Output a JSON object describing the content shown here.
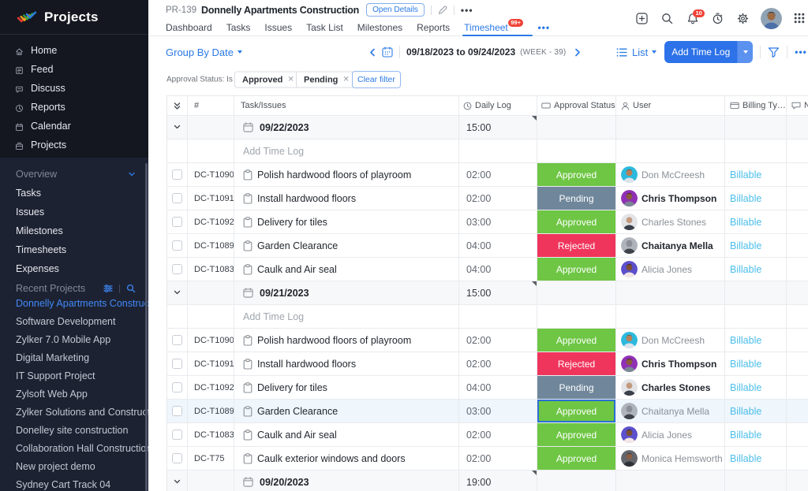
{
  "sidebar": {
    "logo_text": "Projects",
    "menu": [
      {
        "icon": "home-icon",
        "label": "Home"
      },
      {
        "icon": "feed-icon",
        "label": "Feed"
      },
      {
        "icon": "discuss-icon",
        "label": "Discuss"
      },
      {
        "icon": "reports-icon",
        "label": "Reports"
      },
      {
        "icon": "calendar-icon",
        "label": "Calendar"
      },
      {
        "icon": "projects-icon",
        "label": "Projects"
      }
    ],
    "overview_label": "Overview",
    "overview_items": [
      "Tasks",
      "Issues",
      "Milestones",
      "Timesheets",
      "Expenses"
    ],
    "recent_label": "Recent Projects",
    "recent_items": [
      {
        "label": "Donnelly Apartments Construct",
        "active": true
      },
      {
        "label": "Software Development",
        "active": false
      },
      {
        "label": "Zylker 7.0 Mobile App",
        "active": false
      },
      {
        "label": "Digital Marketing",
        "active": false
      },
      {
        "label": "IT Support Project",
        "active": false
      },
      {
        "label": "Zylsoft Web App",
        "active": false
      },
      {
        "label": "Zylker Solutions and Constructio",
        "active": false
      },
      {
        "label": "Donelley site construction",
        "active": false
      },
      {
        "label": "Collaboration Hall Constructions",
        "active": false
      },
      {
        "label": "New project demo",
        "active": false
      },
      {
        "label": "Sydney Cart Track 04",
        "active": false
      }
    ]
  },
  "header": {
    "project_id": "PR-139",
    "project_name": "Donnelly Apartments Construction",
    "open_details_label": "Open Details",
    "tabs": [
      "Dashboard",
      "Tasks",
      "Issues",
      "Task List",
      "Milestones",
      "Reports"
    ],
    "active_tab": "Timesheet",
    "active_tab_badge": "99+",
    "notification_count": "10"
  },
  "toolbar": {
    "group_by_label": "Group By Date",
    "date_range": "09/18/2023 to 09/24/2023",
    "week_label": "(WEEK - 39)",
    "view_label": "List",
    "add_button_label": "Add Time Log"
  },
  "filter": {
    "label": "Approval Status: Is",
    "chips": [
      "Approved",
      "Pending"
    ],
    "chip_close": "✕",
    "clear_label": "Clear filter"
  },
  "table": {
    "headers": {
      "id": "#",
      "task": "Task/Issues",
      "log": "Daily Log",
      "status": "Approval Status",
      "user": "User",
      "billing": "Billing Type",
      "notes": "Notes"
    },
    "add_row_label": "Add Time Log",
    "groups": [
      {
        "date": "09/22/2023",
        "total": "15:00",
        "rows": [
          {
            "id": "DC-T1090",
            "task": "Polish hardwood floors of playroom",
            "log": "02:00",
            "status": "Approved",
            "status_key": "approved",
            "user": "Don McCreesh",
            "avatar": "don",
            "user_dark": false,
            "billing": "Billable",
            "selected": false
          },
          {
            "id": "DC-T1091",
            "task": "Install hardwood floors",
            "log": "02:00",
            "status": "Pending",
            "status_key": "pending",
            "user": "Chris Thompson",
            "avatar": "chris",
            "user_dark": true,
            "billing": "Billable",
            "selected": false
          },
          {
            "id": "DC-T1092",
            "task": "Delivery for tiles",
            "log": "03:00",
            "status": "Approved",
            "status_key": "approved",
            "user": "Charles Stones",
            "avatar": "charles",
            "user_dark": false,
            "billing": "Billable",
            "selected": false
          },
          {
            "id": "DC-T1089",
            "task": "Garden Clearance",
            "log": "04:00",
            "status": "Rejected",
            "status_key": "rejected",
            "user": "Chaitanya Mella",
            "avatar": "chaitanya",
            "user_dark": true,
            "billing": "Billable",
            "selected": false
          },
          {
            "id": "DC-T1083",
            "task": "Caulk and Air seal",
            "log": "04:00",
            "status": "Approved",
            "status_key": "approved",
            "user": "Alicia Jones",
            "avatar": "alicia",
            "user_dark": false,
            "billing": "Billable",
            "selected": false
          }
        ]
      },
      {
        "date": "09/21/2023",
        "total": "15:00",
        "rows": [
          {
            "id": "DC-T1090",
            "task": "Polish hardwood floors of playroom",
            "log": "02:00",
            "status": "Approved",
            "status_key": "approved",
            "user": "Don McCreesh",
            "avatar": "don",
            "user_dark": false,
            "billing": "Billable",
            "selected": false
          },
          {
            "id": "DC-T1091",
            "task": "Install hardwood floors",
            "log": "02:00",
            "status": "Rejected",
            "status_key": "rejected",
            "user": "Chris Thompson",
            "avatar": "chris",
            "user_dark": true,
            "billing": "Billable",
            "selected": false
          },
          {
            "id": "DC-T1092",
            "task": "Delivery for tiles",
            "log": "04:00",
            "status": "Pending",
            "status_key": "pending",
            "user": "Charles Stones",
            "avatar": "charles",
            "user_dark": true,
            "billing": "Billable",
            "selected": false
          },
          {
            "id": "DC-T1089",
            "task": "Garden Clearance",
            "log": "03:00",
            "status": "Approved",
            "status_key": "approved",
            "user": "Chaitanya Mella",
            "avatar": "chaitanya",
            "user_dark": false,
            "billing": "Billable",
            "selected": true
          },
          {
            "id": "DC-T1083",
            "task": "Caulk and Air seal",
            "log": "02:00",
            "status": "Approved",
            "status_key": "approved",
            "user": "Alicia Jones",
            "avatar": "alicia",
            "user_dark": false,
            "billing": "Billable",
            "selected": false
          },
          {
            "id": "DC-T75",
            "task": "Caulk exterior windows and doors",
            "log": "02:00",
            "status": "Approved",
            "status_key": "approved",
            "user": "Monica Hemsworth",
            "avatar": "monica",
            "user_dark": false,
            "billing": "Billable",
            "selected": false
          }
        ]
      },
      {
        "date": "09/20/2023",
        "total": "19:00",
        "rows": []
      }
    ]
  },
  "icons": {
    "more_dots": "•••"
  },
  "colors": {
    "approved": "#6ec644",
    "pending": "#70879b",
    "rejected": "#f0355c",
    "accent_blue": "#2a79e6",
    "billable_blue": "#4bbeea",
    "badge_red": "#ef4237"
  },
  "avatars": {
    "don": {
      "bg": "#2cb9dd",
      "skin": "#b97f58",
      "hair": "#6b4a2f",
      "shirt": "#dce3ea"
    },
    "chris": {
      "bg": "#9031b5",
      "skin": "#8a5a3b",
      "hair": "#1f1a16",
      "shirt": "#7a8795"
    },
    "charles": {
      "bg": "#e3e4e8",
      "skin": "#c39a7e",
      "hair": "#d8d3cd",
      "shirt": "#3a4049"
    },
    "chaitanya": {
      "bg": "#aeb3bc",
      "skin": "#8c8f96",
      "hair": "#7d8087",
      "shirt": "#3f444c"
    },
    "alicia": {
      "bg": "#5d50cc",
      "skin": "#7c4f35",
      "hair": "#241d18",
      "shirt": "#f2e7e4"
    },
    "monica": {
      "bg": "#63666d",
      "skin": "#8a5f46",
      "hair": "#26201c",
      "shirt": "#2f3339"
    },
    "me": {
      "bg": "#8fa3b5",
      "skin": "#9c6b45",
      "hair": "#241f1c",
      "shirt": "#4c6fa8"
    }
  }
}
